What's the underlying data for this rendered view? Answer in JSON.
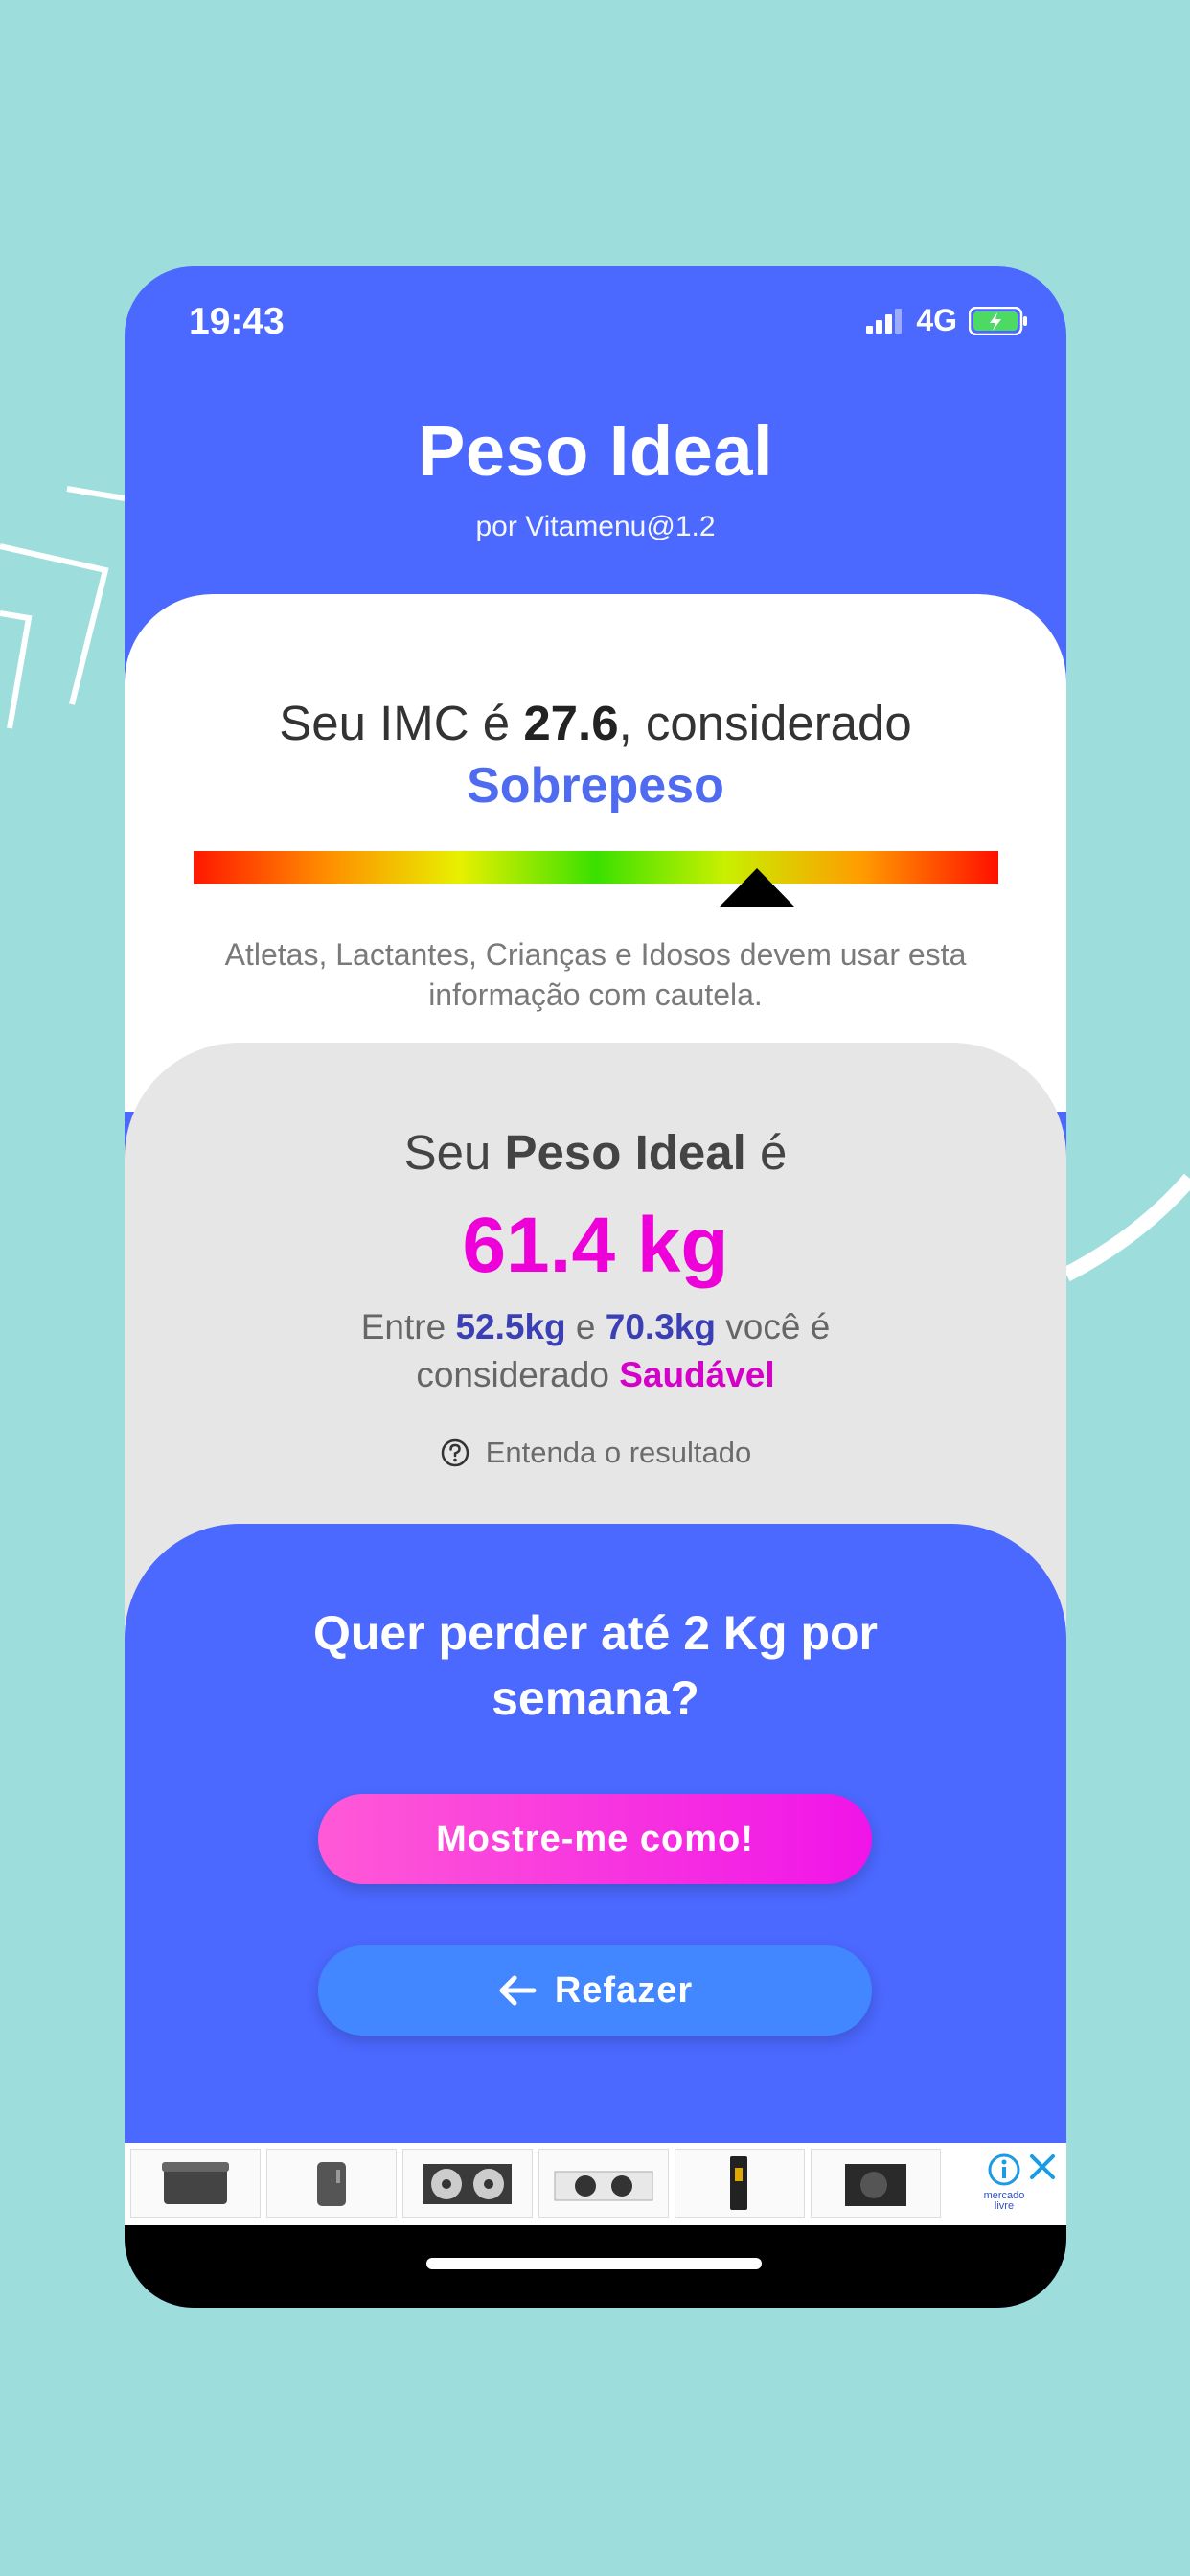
{
  "status_bar": {
    "time": "19:43",
    "network": "4G",
    "icons": [
      "signal-icon",
      "battery-charging-icon"
    ]
  },
  "header": {
    "title": "Peso Ideal",
    "subtitle": "por Vitamenu@1.2"
  },
  "imc": {
    "prefix": "Seu IMC é ",
    "value": "27.6",
    "suffix": ", considerado",
    "classification": "Sobrepeso",
    "scale_position": 0.7,
    "warning": "Atletas, Lactantes, Crianças e Idosos devem usar esta informação com cautela."
  },
  "ideal_weight": {
    "prefix": "Seu ",
    "label": "Peso Ideal",
    "suffix": " é",
    "value": "61.4 kg",
    "range_prefix": "Entre ",
    "min": "52.5kg",
    "range_mid": " e ",
    "max": "70.3kg",
    "range_suffix": " você é considerado ",
    "status": "Saudável",
    "help_link": "Entenda o resultado"
  },
  "cta": {
    "question": "Quer perder até 2 Kg por semana?",
    "show_button": "Mostre-me como!",
    "redo_button": "Refazer"
  },
  "ad": {
    "brand": "mercado livre",
    "items": [
      "cooler-box",
      "mini-fridge",
      "fan-unit",
      "condenser-unit",
      "tall-cabinet",
      "compressor-unit"
    ]
  },
  "colors": {
    "primary": "#4b68ff",
    "pink": "#ee00d8",
    "background": "#9ddedd",
    "redo_button": "#4287ff"
  }
}
